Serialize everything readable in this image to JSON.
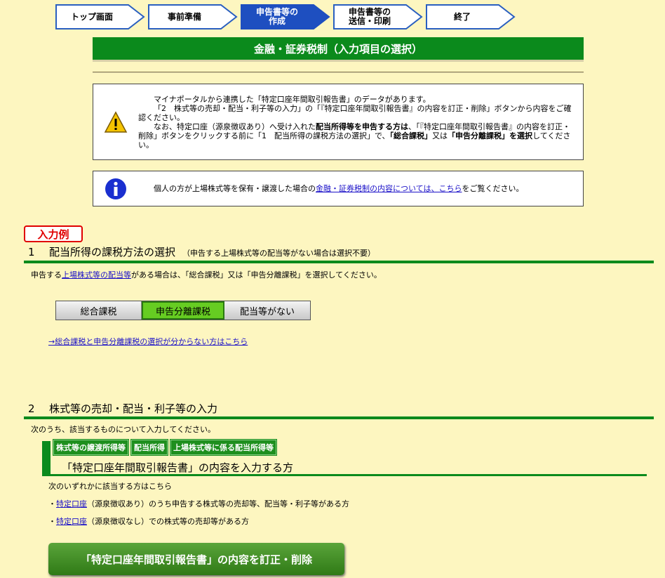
{
  "steps": [
    {
      "label": "トップ画面",
      "active": false
    },
    {
      "label": "事前準備",
      "active": false
    },
    {
      "label": "申告書等の\n作成",
      "active": true
    },
    {
      "label": "申告書等の\n送信・印刷",
      "active": false
    },
    {
      "label": "終了",
      "active": false
    }
  ],
  "header": {
    "title": "金融・証券税制（入力項目の選択）"
  },
  "warning": {
    "line1": "マイナポータルから連携した「特定口座年間取引報告書」のデータがあります。",
    "line2": "「2　株式等の売却・配当・利子等の入力」の「『特定口座年間取引報告書』の内容を訂正・削除」ボタンから内容をご確認ください。",
    "line3_pre": "なお、特定口座（源泉徴収あり）へ受け入れた",
    "line3_bold": "配当所得等を申告する方は",
    "line3_mid": "、「『特定口座年間取引報告書』の内容を訂正・削除」ボタンをクリックする前に「1　配当所得の課税方法の選択」で、",
    "line3_b2": "「総合課税」",
    "line3_or": "又は",
    "line3_b3": "「申告分離課税」",
    "line3_b4": "を選択",
    "line3_end": "してください。"
  },
  "info": {
    "pre": "個人の方が上場株式等を保有・譲渡した場合の",
    "link": "金融・証券税制の内容については、こちら",
    "post": "をご覧ください。"
  },
  "example_tag": "入力例",
  "section1": {
    "num": "1",
    "title": "配当所得の課税方法の選択",
    "note": "（申告する上場株式等の配当等がない場合は選択不要）",
    "desc_pre": "申告する",
    "desc_link": "上場株式等の配当等",
    "desc_post": "がある場合は、「総合課税」又は「申告分離課税」を選択してください。",
    "options": [
      "総合課税",
      "申告分離課税",
      "配当等がない"
    ],
    "selected": "申告分離課税",
    "help_link": "→総合課税と申告分離課税の選択が分からない方はこちら"
  },
  "section2": {
    "num": "2",
    "title": "株式等の売却・配当・利子等の入力",
    "desc": "次のうち、該当するものについて入力してください。",
    "categories": [
      "株式等の譲渡所得等",
      "配当所得",
      "上場株式等に係る配当所得等"
    ],
    "sub_title": "「特定口座年間取引報告書」の内容を入力する方",
    "sub_desc": "次のいずれかに該当する方はこちら",
    "bullet1_link": "特定口座",
    "bullet1_text": "（源泉徴収あり）のうち申告する株式等の売却等、配当等・利子等がある方",
    "bullet2_link": "特定口座",
    "bullet2_text": "（源泉徴収なし）での株式等の売却等がある方",
    "button": "「特定口座年間取引報告書」の内容を訂正・削除"
  },
  "colors": {
    "green": "#0b8a1c",
    "background": "#fdf6c0",
    "link": "#1a10c8",
    "tag_red": "#e00000"
  }
}
